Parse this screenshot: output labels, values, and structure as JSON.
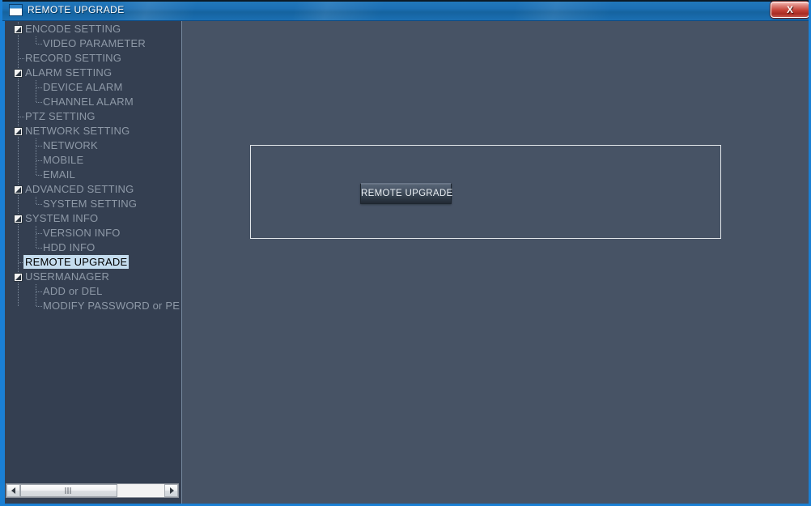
{
  "window": {
    "title": "REMOTE UPGRADE",
    "icon": "window-icon",
    "close_label": "X",
    "accent_color": "#1a7fd4",
    "titlebar_color": "#1c6fb4",
    "sidebar_color": "#343f51",
    "main_color": "#475365",
    "selection_color": "#c4dcee"
  },
  "sidebar": {
    "tree": [
      {
        "label": "ENCODE SETTING",
        "depth": 0,
        "expander": true,
        "selected": false,
        "last_child": false
      },
      {
        "label": "VIDEO PARAMETER",
        "depth": 1,
        "expander": false,
        "selected": false,
        "last_child": true
      },
      {
        "label": "RECORD SETTING",
        "depth": 0,
        "expander": false,
        "selected": false,
        "last_child": false
      },
      {
        "label": "ALARM SETTING",
        "depth": 0,
        "expander": true,
        "selected": false,
        "last_child": false
      },
      {
        "label": "DEVICE ALARM",
        "depth": 1,
        "expander": false,
        "selected": false,
        "last_child": false
      },
      {
        "label": "CHANNEL ALARM",
        "depth": 1,
        "expander": false,
        "selected": false,
        "last_child": true
      },
      {
        "label": "PTZ SETTING",
        "depth": 0,
        "expander": false,
        "selected": false,
        "last_child": false
      },
      {
        "label": "NETWORK SETTING",
        "depth": 0,
        "expander": true,
        "selected": false,
        "last_child": false
      },
      {
        "label": "NETWORK",
        "depth": 1,
        "expander": false,
        "selected": false,
        "last_child": false
      },
      {
        "label": "MOBILE",
        "depth": 1,
        "expander": false,
        "selected": false,
        "last_child": false
      },
      {
        "label": "EMAIL",
        "depth": 1,
        "expander": false,
        "selected": false,
        "last_child": true
      },
      {
        "label": "ADVANCED SETTING",
        "depth": 0,
        "expander": true,
        "selected": false,
        "last_child": false
      },
      {
        "label": "SYSTEM SETTING",
        "depth": 1,
        "expander": false,
        "selected": false,
        "last_child": true
      },
      {
        "label": "SYSTEM INFO",
        "depth": 0,
        "expander": true,
        "selected": false,
        "last_child": false
      },
      {
        "label": "VERSION INFO",
        "depth": 1,
        "expander": false,
        "selected": false,
        "last_child": false
      },
      {
        "label": "HDD INFO",
        "depth": 1,
        "expander": false,
        "selected": false,
        "last_child": true
      },
      {
        "label": "REMOTE UPGRADE",
        "depth": 0,
        "expander": false,
        "selected": true,
        "last_child": false
      },
      {
        "label": "USERMANAGER",
        "depth": 0,
        "expander": true,
        "selected": false,
        "last_child": false
      },
      {
        "label": "ADD or DEL",
        "depth": 1,
        "expander": false,
        "selected": false,
        "last_child": false
      },
      {
        "label": "MODIFY PASSWORD or PE",
        "depth": 1,
        "expander": false,
        "selected": false,
        "last_child": true
      }
    ],
    "scrollbar": {
      "left_arrow": "scroll-left-arrow",
      "right_arrow": "scroll-right-arrow",
      "thumb": "scroll-thumb"
    }
  },
  "main": {
    "panel": {
      "button_label": "REMOTE UPGRADE"
    }
  }
}
